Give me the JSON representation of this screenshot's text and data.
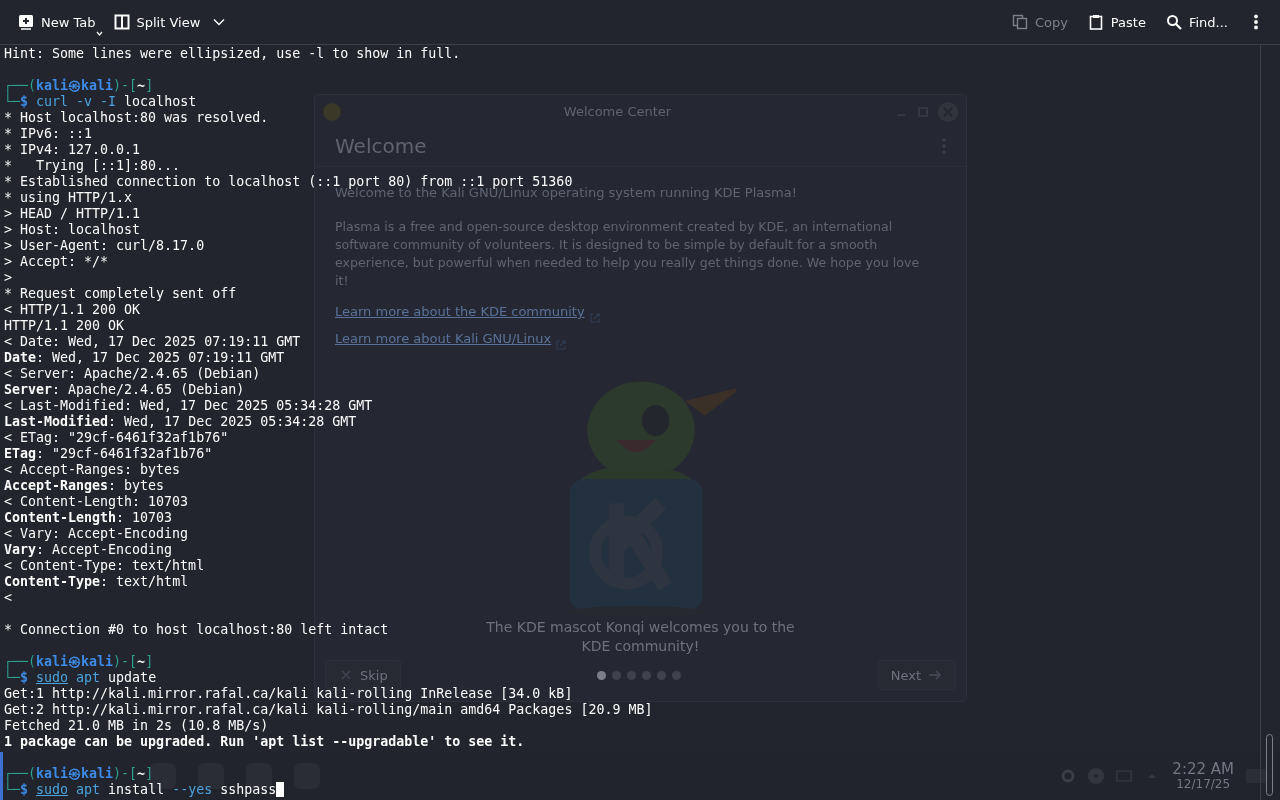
{
  "toolbar": {
    "left": [
      {
        "label": "New Tab"
      },
      {
        "label": "Split View"
      }
    ],
    "right": [
      {
        "label": "Copy",
        "disabled": true
      },
      {
        "label": "Paste",
        "disabled": false
      },
      {
        "label": "Find...",
        "disabled": false
      }
    ]
  },
  "welcome_window": {
    "title": "Welcome Center",
    "heading": "Welcome",
    "intro": "Welcome to the Kali GNU/Linux operating system running KDE Plasma!",
    "description": "Plasma is a free and open-source desktop environment created by KDE, an international software community of volunteers. It is designed to be simple by default for a smooth experience, but powerful when needed to help you really get things done. We hope you love it!",
    "links": [
      "Learn more about the KDE community",
      "Learn more about Kali GNU/Linux"
    ],
    "caption": "The KDE mascot Konqi welcomes you to the KDE community!",
    "skip_button": "Skip",
    "next_button": "Next",
    "pages": [
      {
        "selected": true
      },
      {
        "selected": false
      },
      {
        "selected": false
      },
      {
        "selected": false
      },
      {
        "selected": false
      },
      {
        "selected": false
      }
    ]
  },
  "taskbar": {
    "time": "2:22 AM",
    "date": "12/17/25"
  },
  "terminal": {
    "cursor": true,
    "lines": [
      {
        "kind": "text",
        "segments": [
          {
            "kind": "text",
            "text": "Hint: Some lines were ellipsized, use -l to show in full."
          }
        ]
      },
      {
        "kind": "blank"
      },
      {
        "kind": "text",
        "segments": [
          {
            "kind": "frame",
            "text": "┌──("
          },
          {
            "kind": "user",
            "text": "kali㉿kali"
          },
          {
            "kind": "frame",
            "text": ")-["
          },
          {
            "kind": "path",
            "text": "~"
          },
          {
            "kind": "frame",
            "text": "]"
          }
        ]
      },
      {
        "kind": "text",
        "segments": [
          {
            "kind": "frame",
            "text": "└─"
          },
          {
            "kind": "dollar",
            "text": "$ "
          },
          {
            "kind": "command",
            "text": "curl -v -I"
          },
          {
            "kind": "text",
            "text": " localhost"
          }
        ]
      },
      {
        "kind": "text",
        "segments": [
          {
            "kind": "text",
            "text": "* Host localhost:80 was resolved."
          }
        ]
      },
      {
        "kind": "text",
        "segments": [
          {
            "kind": "text",
            "text": "* IPv6: ::1"
          }
        ]
      },
      {
        "kind": "text",
        "segments": [
          {
            "kind": "text",
            "text": "* IPv4: 127.0.0.1"
          }
        ]
      },
      {
        "kind": "text",
        "segments": [
          {
            "kind": "text",
            "text": "*   Trying [::1]:80..."
          }
        ]
      },
      {
        "kind": "text",
        "segments": [
          {
            "kind": "text",
            "text": "* Established connection to localhost (::1 port 80) from ::1 port 51360"
          }
        ]
      },
      {
        "kind": "text",
        "segments": [
          {
            "kind": "text",
            "text": "* using HTTP/1.x"
          }
        ]
      },
      {
        "kind": "text",
        "segments": [
          {
            "kind": "text",
            "text": "> HEAD / HTTP/1.1"
          }
        ]
      },
      {
        "kind": "text",
        "segments": [
          {
            "kind": "text",
            "text": "> Host: localhost"
          }
        ]
      },
      {
        "kind": "text",
        "segments": [
          {
            "kind": "text",
            "text": "> User-Agent: curl/8.17.0"
          }
        ]
      },
      {
        "kind": "text",
        "segments": [
          {
            "kind": "text",
            "text": "> Accept: */*"
          }
        ]
      },
      {
        "kind": "text",
        "segments": [
          {
            "kind": "text",
            "text": ">"
          }
        ]
      },
      {
        "kind": "text",
        "segments": [
          {
            "kind": "text",
            "text": "* Request completely sent off"
          }
        ]
      },
      {
        "kind": "text",
        "segments": [
          {
            "kind": "text",
            "text": "< HTTP/1.1 200 OK"
          }
        ]
      },
      {
        "kind": "text",
        "segments": [
          {
            "kind": "text",
            "text": "HTTP/1.1 200 OK"
          }
        ]
      },
      {
        "kind": "text",
        "segments": [
          {
            "kind": "text",
            "text": "< Date: Wed, 17 Dec 2025 07:19:11 GMT"
          }
        ]
      },
      {
        "kind": "text",
        "segments": [
          {
            "kind": "bold",
            "text": "Date"
          },
          {
            "kind": "text",
            "text": ": Wed, 17 Dec 2025 07:19:11 GMT"
          }
        ]
      },
      {
        "kind": "text",
        "segments": [
          {
            "kind": "text",
            "text": "< Server: Apache/2.4.65 (Debian)"
          }
        ]
      },
      {
        "kind": "text",
        "segments": [
          {
            "kind": "bold",
            "text": "Server"
          },
          {
            "kind": "text",
            "text": ": Apache/2.4.65 (Debian)"
          }
        ]
      },
      {
        "kind": "text",
        "segments": [
          {
            "kind": "text",
            "text": "< Last-Modified: Wed, 17 Dec 2025 05:34:28 GMT"
          }
        ]
      },
      {
        "kind": "text",
        "segments": [
          {
            "kind": "bold",
            "text": "Last-Modified"
          },
          {
            "kind": "text",
            "text": ": Wed, 17 Dec 2025 05:34:28 GMT"
          }
        ]
      },
      {
        "kind": "text",
        "segments": [
          {
            "kind": "text",
            "text": "< ETag: \"29cf-6461f32af1b76\""
          }
        ]
      },
      {
        "kind": "text",
        "segments": [
          {
            "kind": "bold",
            "text": "ETag"
          },
          {
            "kind": "text",
            "text": ": \"29cf-6461f32af1b76\""
          }
        ]
      },
      {
        "kind": "text",
        "segments": [
          {
            "kind": "text",
            "text": "< Accept-Ranges: bytes"
          }
        ]
      },
      {
        "kind": "text",
        "segments": [
          {
            "kind": "bold",
            "text": "Accept-Ranges"
          },
          {
            "kind": "text",
            "text": ": bytes"
          }
        ]
      },
      {
        "kind": "text",
        "segments": [
          {
            "kind": "text",
            "text": "< Content-Length: 10703"
          }
        ]
      },
      {
        "kind": "text",
        "segments": [
          {
            "kind": "bold",
            "text": "Content-Length"
          },
          {
            "kind": "text",
            "text": ": 10703"
          }
        ]
      },
      {
        "kind": "text",
        "segments": [
          {
            "kind": "text",
            "text": "< Vary: Accept-Encoding"
          }
        ]
      },
      {
        "kind": "text",
        "segments": [
          {
            "kind": "bold",
            "text": "Vary"
          },
          {
            "kind": "text",
            "text": ": Accept-Encoding"
          }
        ]
      },
      {
        "kind": "text",
        "segments": [
          {
            "kind": "text",
            "text": "< Content-Type: text/html"
          }
        ]
      },
      {
        "kind": "text",
        "segments": [
          {
            "kind": "bold",
            "text": "Content-Type"
          },
          {
            "kind": "text",
            "text": ": text/html"
          }
        ]
      },
      {
        "kind": "text",
        "segments": [
          {
            "kind": "text",
            "text": "<"
          }
        ]
      },
      {
        "kind": "blank"
      },
      {
        "kind": "text",
        "segments": [
          {
            "kind": "text",
            "text": "* Connection #0 to host localhost:80 left intact"
          }
        ]
      },
      {
        "kind": "blank"
      },
      {
        "kind": "text",
        "segments": [
          {
            "kind": "frame",
            "text": "┌──("
          },
          {
            "kind": "user",
            "text": "kali㉿kali"
          },
          {
            "kind": "frame",
            "text": ")-["
          },
          {
            "kind": "path",
            "text": "~"
          },
          {
            "kind": "frame",
            "text": "]"
          }
        ]
      },
      {
        "kind": "text",
        "segments": [
          {
            "kind": "frame",
            "text": "└─"
          },
          {
            "kind": "dollar",
            "text": "$ "
          },
          {
            "kind": "underlined-command",
            "text": "sudo"
          },
          {
            "kind": "command",
            "text": " apt"
          },
          {
            "kind": "text",
            "text": " update"
          }
        ]
      },
      {
        "kind": "text",
        "segments": [
          {
            "kind": "text",
            "text": "Get:1 http://kali.mirror.rafal.ca/kali kali-rolling InRelease [34.0 kB]"
          }
        ]
      },
      {
        "kind": "text",
        "segments": [
          {
            "kind": "text",
            "text": "Get:2 http://kali.mirror.rafal.ca/kali kali-rolling/main amd64 Packages [20.9 MB]"
          }
        ]
      },
      {
        "kind": "text",
        "segments": [
          {
            "kind": "text",
            "text": "Fetched 21.0 MB in 2s (10.8 MB/s)"
          }
        ]
      },
      {
        "kind": "text",
        "segments": [
          {
            "kind": "bold",
            "text": "1 package can be upgraded. Run 'apt list --upgradable' to see it."
          }
        ]
      },
      {
        "kind": "blank"
      },
      {
        "kind": "text",
        "segments": [
          {
            "kind": "frame",
            "text": "┌──("
          },
          {
            "kind": "user",
            "text": "kali㉿kali"
          },
          {
            "kind": "frame",
            "text": ")-["
          },
          {
            "kind": "path",
            "text": "~"
          },
          {
            "kind": "frame",
            "text": "]"
          }
        ]
      },
      {
        "kind": "text",
        "segments": [
          {
            "kind": "frame",
            "text": "└─"
          },
          {
            "kind": "dollar",
            "text": "$ "
          },
          {
            "kind": "underlined-command",
            "text": "sudo"
          },
          {
            "kind": "command",
            "text": " apt"
          },
          {
            "kind": "text",
            "text": " install"
          },
          {
            "kind": "command",
            "text": " --yes"
          },
          {
            "kind": "text",
            "text": " sshpass"
          }
        ]
      }
    ]
  }
}
